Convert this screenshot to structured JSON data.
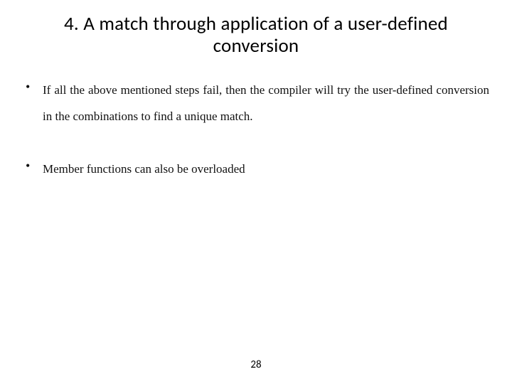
{
  "title": "4. A match through application of a user-defined conversion",
  "bullets": [
    "If all the above mentioned steps fail, then the compiler will try the user-defined conversion in the combinations to find a unique match.",
    "Member functions can also be overloaded"
  ],
  "page_number": "28"
}
